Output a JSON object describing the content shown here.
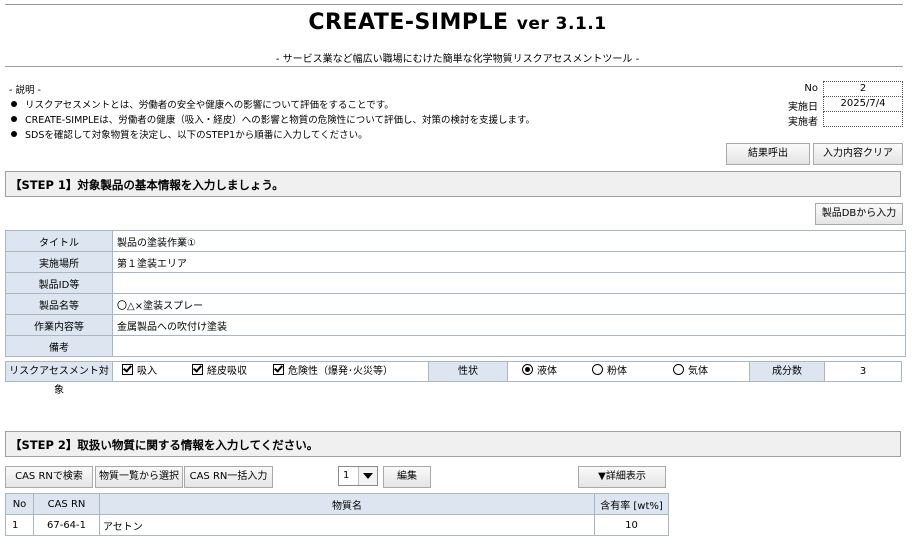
{
  "header": {
    "title": "CREATE-SIMPLE",
    "version": "ver 3.1.1",
    "subtitle": "- サービス業など幅広い職場にむけた簡単な化学物質リスクアセスメントツール -"
  },
  "description": {
    "heading": "- 説明 -",
    "lines": [
      "リスクアセスメントとは、労働者の安全や健康への影響について評価をすることです。",
      "CREATE-SIMPLEは、労働者の健康（吸入・経皮）への影響と物質の危険性について評価し、対策の検討を支援します。",
      "SDSを確認して対象物質を決定し、以下のSTEP1から順番に入力してください。"
    ]
  },
  "meta": {
    "no_label": "No",
    "no_value": "2",
    "date_label": "実施日",
    "date_value": "2025/7/4",
    "person_label": "実施者",
    "person_value": ""
  },
  "top_buttons": {
    "recall": "結果呼出",
    "clear": "入力内容クリア"
  },
  "step1": {
    "title": "【STEP 1】対象製品の基本情報を入力しましょう。",
    "db_button": "製品DBから入力",
    "rows": [
      {
        "label": "タイトル",
        "value": "製品の塗装作業①"
      },
      {
        "label": "実施場所",
        "value": "第１塗装エリア"
      },
      {
        "label": "製品ID等",
        "value": ""
      },
      {
        "label": "製品名等",
        "value": "〇△×塗装スプレー"
      },
      {
        "label": "作業内容等",
        "value": "金属製品への吹付け塗装"
      },
      {
        "label": "備考",
        "value": ""
      }
    ],
    "ra_target_label": "リスクアセスメント対象",
    "ra_targets": [
      {
        "label": "吸入",
        "checked": true
      },
      {
        "label": "経皮吸収",
        "checked": true
      },
      {
        "label": "危険性（爆発･火災等）",
        "checked": true
      }
    ],
    "state_label": "性状",
    "states": [
      {
        "label": "液体",
        "selected": true
      },
      {
        "label": "粉体",
        "selected": false
      },
      {
        "label": "気体",
        "selected": false
      }
    ],
    "components_label": "成分数",
    "components_value": "3"
  },
  "step2": {
    "title": "【STEP 2】取扱い物質に関する情報を入力してください。",
    "buttons": {
      "cas_search": "CAS RNで検索",
      "substance_list": "物質一覧から選択",
      "cas_bulk": "CAS RN一括入力",
      "edit": "編集",
      "details": "▼詳細表示"
    },
    "selector_value": "1",
    "columns": [
      "No",
      "CAS RN",
      "物質名",
      "含有率 [wt%]"
    ],
    "rows": [
      {
        "no": "1",
        "cas": "67-64-1",
        "name": "アセトン",
        "content": "10"
      }
    ]
  }
}
